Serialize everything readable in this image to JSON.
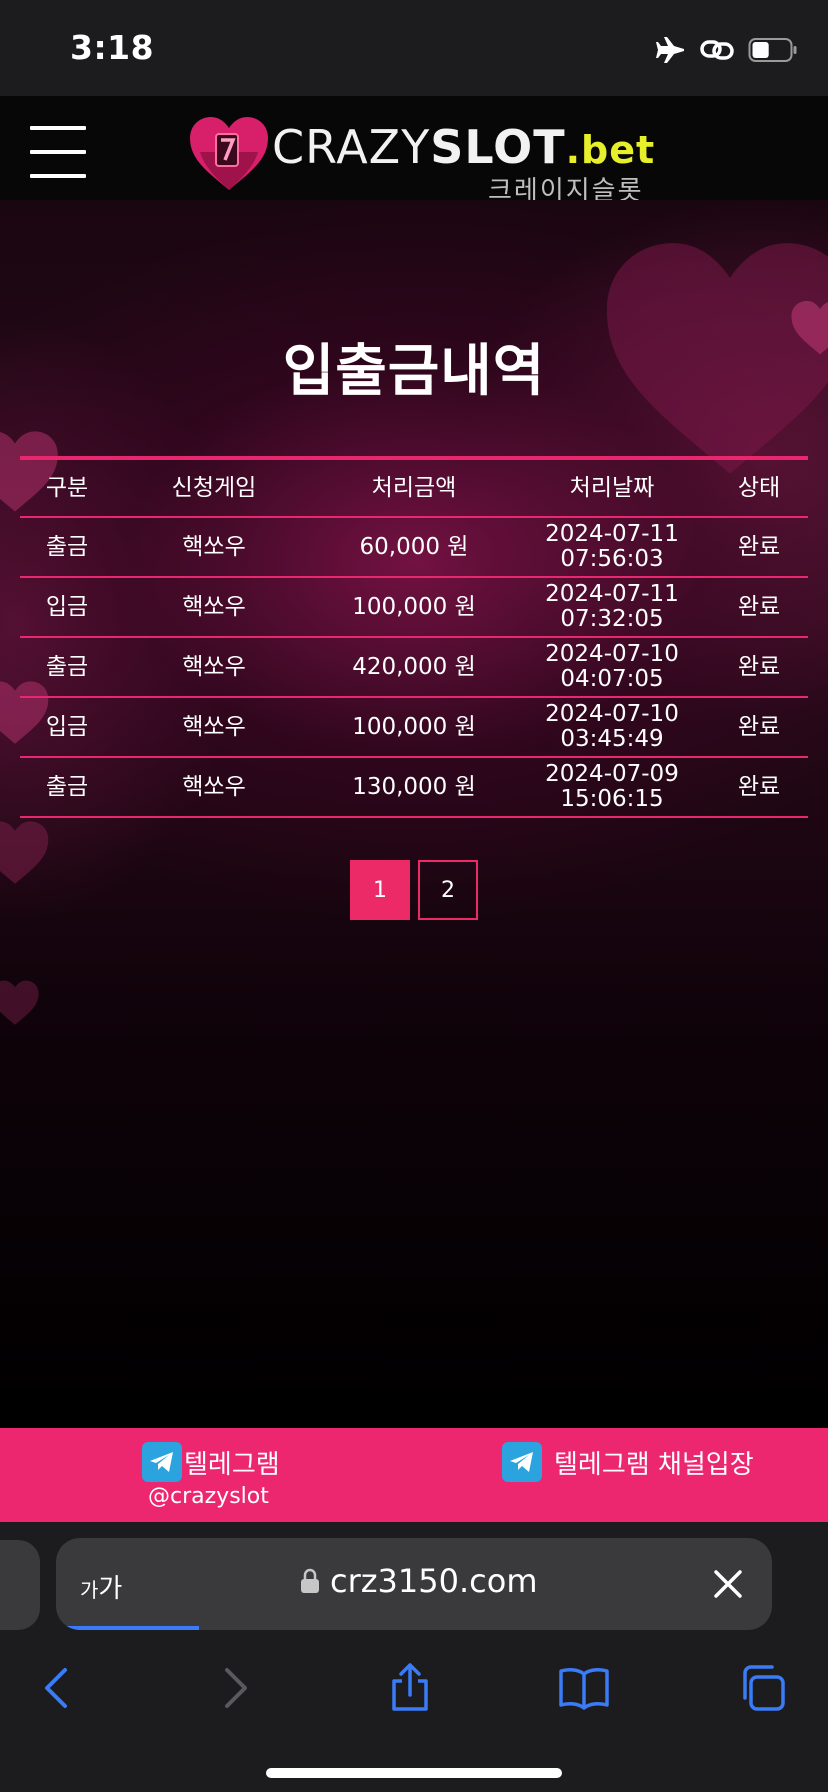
{
  "status_bar": {
    "time": "3:18",
    "icons": [
      "airplane-icon",
      "link-icon",
      "battery-icon"
    ],
    "battery_level": 0.45
  },
  "header": {
    "menu_icon": "hamburger-icon",
    "logo": {
      "text_crazy": "CRAZY",
      "text_slot": "SLOT",
      "text_bet": ".bet",
      "korean": "크레이지슬롯"
    }
  },
  "page": {
    "title": "입출금내역"
  },
  "table": {
    "headers": [
      "구분",
      "신청게임",
      "처리금액",
      "처리날짜",
      "상태"
    ],
    "rows": [
      {
        "type": "출금",
        "game": "핵쏘우",
        "amount": "60,000 원",
        "date": "2024-07-11",
        "time": "07:56:03",
        "status": "완료"
      },
      {
        "type": "입금",
        "game": "핵쏘우",
        "amount": "100,000 원",
        "date": "2024-07-11",
        "time": "07:32:05",
        "status": "완료"
      },
      {
        "type": "출금",
        "game": "핵쏘우",
        "amount": "420,000 원",
        "date": "2024-07-10",
        "time": "04:07:05",
        "status": "완료"
      },
      {
        "type": "입금",
        "game": "핵쏘우",
        "amount": "100,000 원",
        "date": "2024-07-10",
        "time": "03:45:49",
        "status": "완료"
      },
      {
        "type": "출금",
        "game": "핵쏘우",
        "amount": "130,000 원",
        "date": "2024-07-09",
        "time": "15:06:15",
        "status": "완료"
      }
    ]
  },
  "pagination": {
    "pages": [
      "1",
      "2"
    ],
    "current": "1"
  },
  "telegram": {
    "left_label": "텔레그램",
    "left_handle": "@crazyslot",
    "right_label": "텔레그램 채널입장",
    "icon": "telegram-icon"
  },
  "browser": {
    "aa_label_small": "가",
    "aa_label": "가",
    "url": "crz3150.com",
    "lock_icon": "lock-icon",
    "close_icon": "close-icon",
    "load_progress": 0.2,
    "toolbar_icons": [
      "back-icon",
      "forward-icon",
      "share-icon",
      "bookmarks-icon",
      "tabs-icon"
    ]
  },
  "colors": {
    "accent_pink": "#ec2770",
    "table_line": "#e8276f",
    "logo_bet_yellow": "#e6ef2a",
    "safari_blue": "#3a7bf7",
    "telegram_blue": "#2aa3df"
  }
}
